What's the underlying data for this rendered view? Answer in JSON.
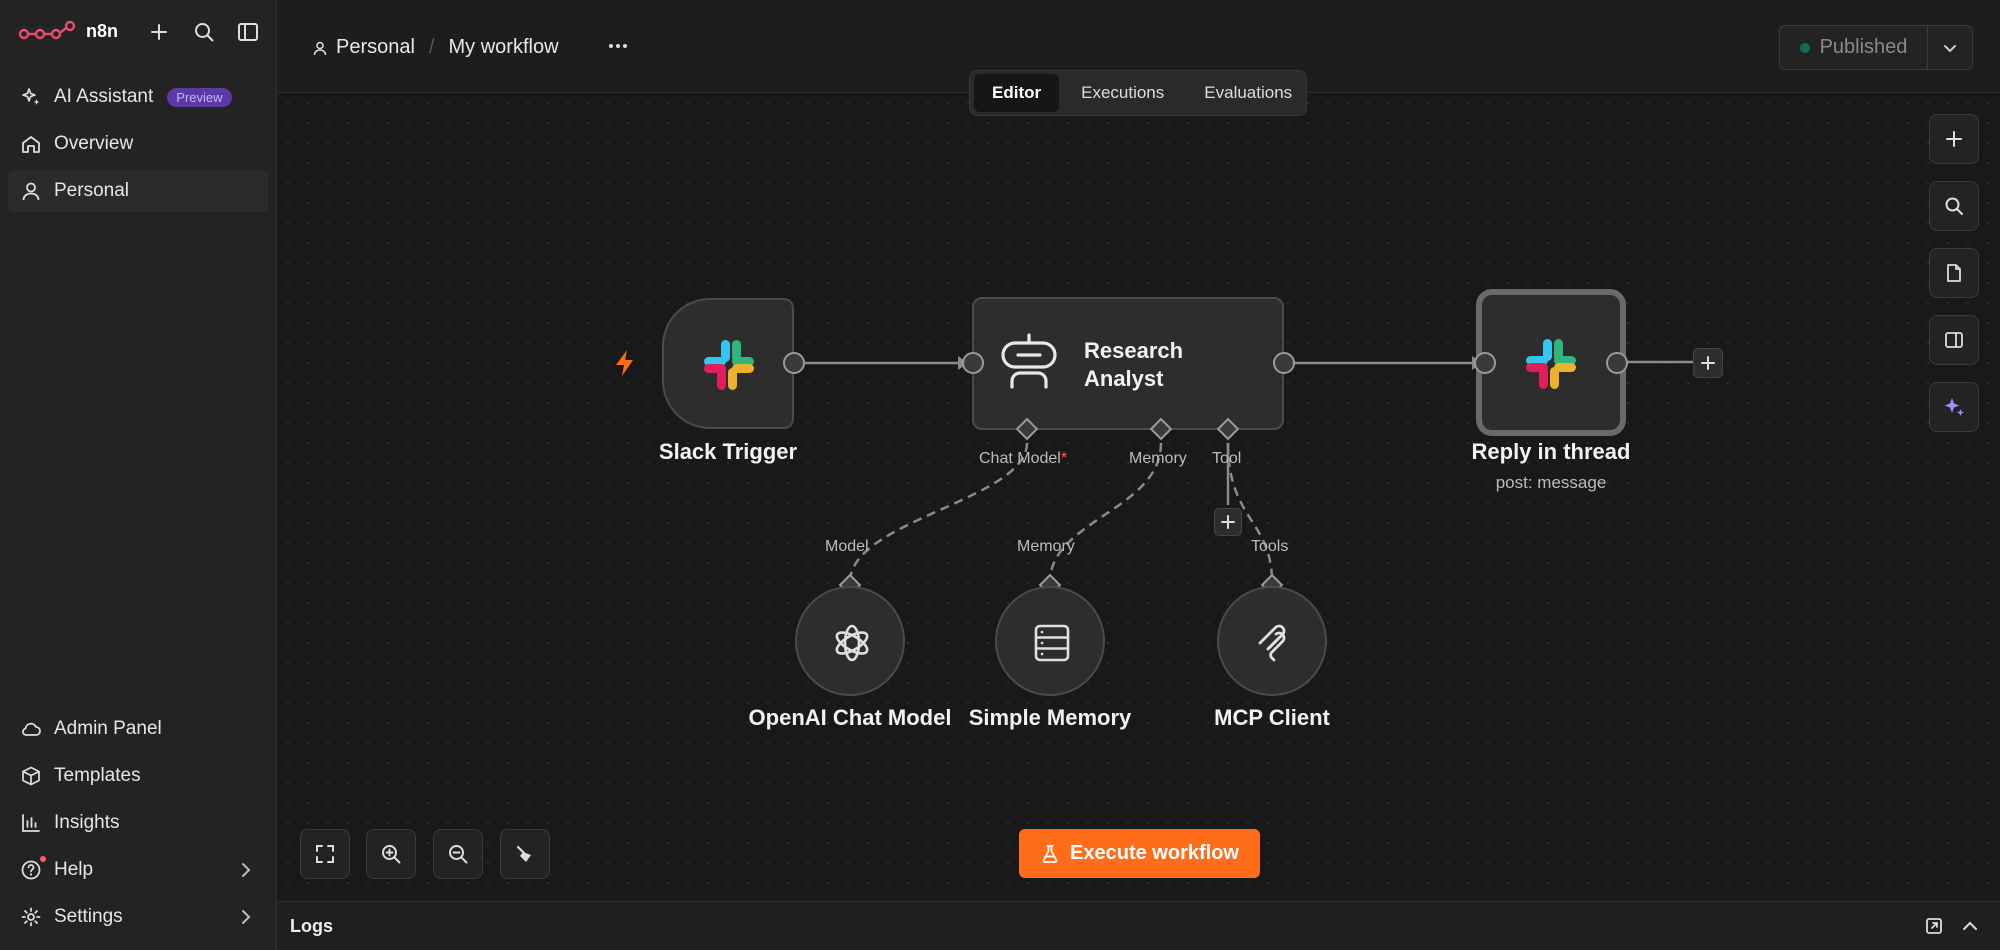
{
  "app": {
    "name": "n8n"
  },
  "sidebar": {
    "top_items": [
      {
        "label": "AI Assistant",
        "badge": "Preview",
        "icon": "sparkles-icon"
      },
      {
        "label": "Overview",
        "icon": "home-icon"
      },
      {
        "label": "Personal",
        "icon": "user-icon"
      }
    ],
    "bottom_items": [
      {
        "label": "Admin Panel",
        "icon": "cloud-icon"
      },
      {
        "label": "Templates",
        "icon": "box-icon"
      },
      {
        "label": "Insights",
        "icon": "bar-chart-icon"
      },
      {
        "label": "Help",
        "icon": "help-circle-icon"
      },
      {
        "label": "Settings",
        "icon": "gear-icon"
      }
    ]
  },
  "header": {
    "project": "Personal",
    "separator": "/",
    "workflow_name": "My workflow",
    "publish_label": "Published",
    "tabs": [
      "Editor",
      "Executions",
      "Evaluations"
    ],
    "active_tab": "Editor"
  },
  "workflow": {
    "nodes": {
      "slack_trigger": {
        "label": "Slack Trigger"
      },
      "agent": {
        "title_line1": "Research",
        "title_line2": "Analyst",
        "ports": {
          "chat_model": "Chat Model",
          "required_mark": "*",
          "memory": "Memory",
          "tool": "Tool"
        }
      },
      "reply": {
        "label": "Reply in thread",
        "sub": "post: message"
      },
      "openai": {
        "label": "OpenAI Chat Model",
        "port": "Model"
      },
      "memory": {
        "label": "Simple Memory",
        "port": "Memory"
      },
      "mcp": {
        "label": "MCP Client",
        "port": "Tools"
      }
    }
  },
  "execute_label": "Execute workflow",
  "logs_label": "Logs",
  "colors": {
    "accent": "#ff6d1a",
    "brand": "#ea4b71",
    "preview_badge": "#5b3aa6"
  }
}
